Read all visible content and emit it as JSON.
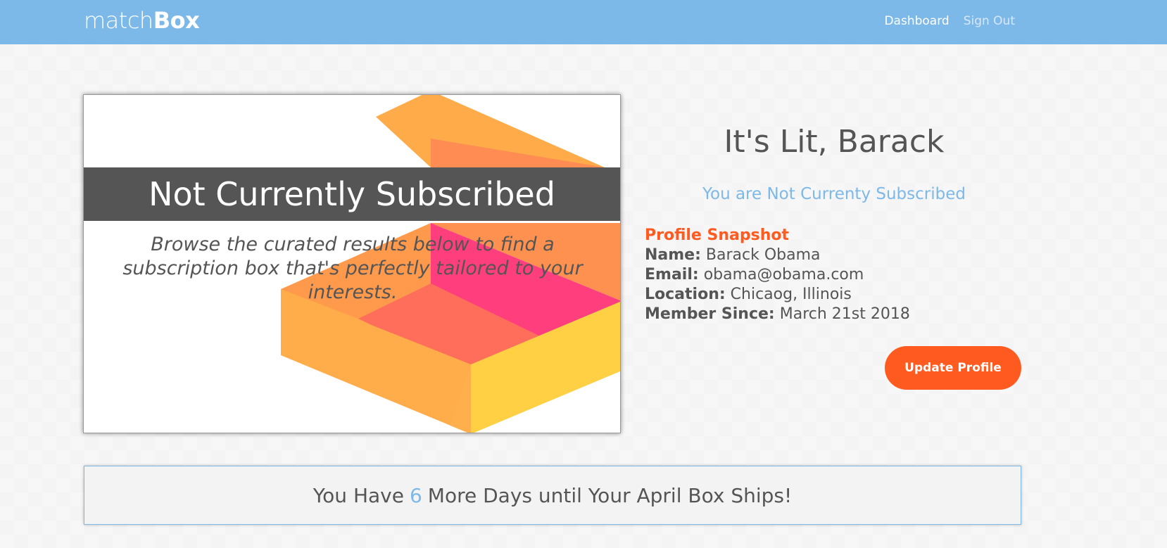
{
  "brand": {
    "light": "match",
    "bold": "Box"
  },
  "nav": {
    "dashboard": "Dashboard",
    "sign_out": "Sign Out"
  },
  "hero": {
    "band_title": "Not Currently Subscribed",
    "subtitle": "Browse the curated results below to find a subscription box that's perfectly tailored to your interests."
  },
  "profile": {
    "greeting": "It's Lit, Barack",
    "status": "You are Not Currenty Subscribed",
    "snapshot_title": "Profile Snapshot",
    "name_label": "Name:",
    "name": "Barack Obama",
    "email_label": "Email:",
    "email": "obama@obama.com",
    "location_label": "Location:",
    "location": "Chicaog, Illinois",
    "member_label": "Member Since:",
    "member_since": "March 21st 2018",
    "update_button": "Update Profile"
  },
  "countdown": {
    "prefix": "You Have",
    "days": "6",
    "suffix": "More Days until Your April Box Ships!"
  },
  "colors": {
    "nav_bg": "#7cb8e8",
    "accent_orange": "#ff5a1f",
    "accent_blue": "#7cb8e8",
    "band_gray": "#555555"
  }
}
